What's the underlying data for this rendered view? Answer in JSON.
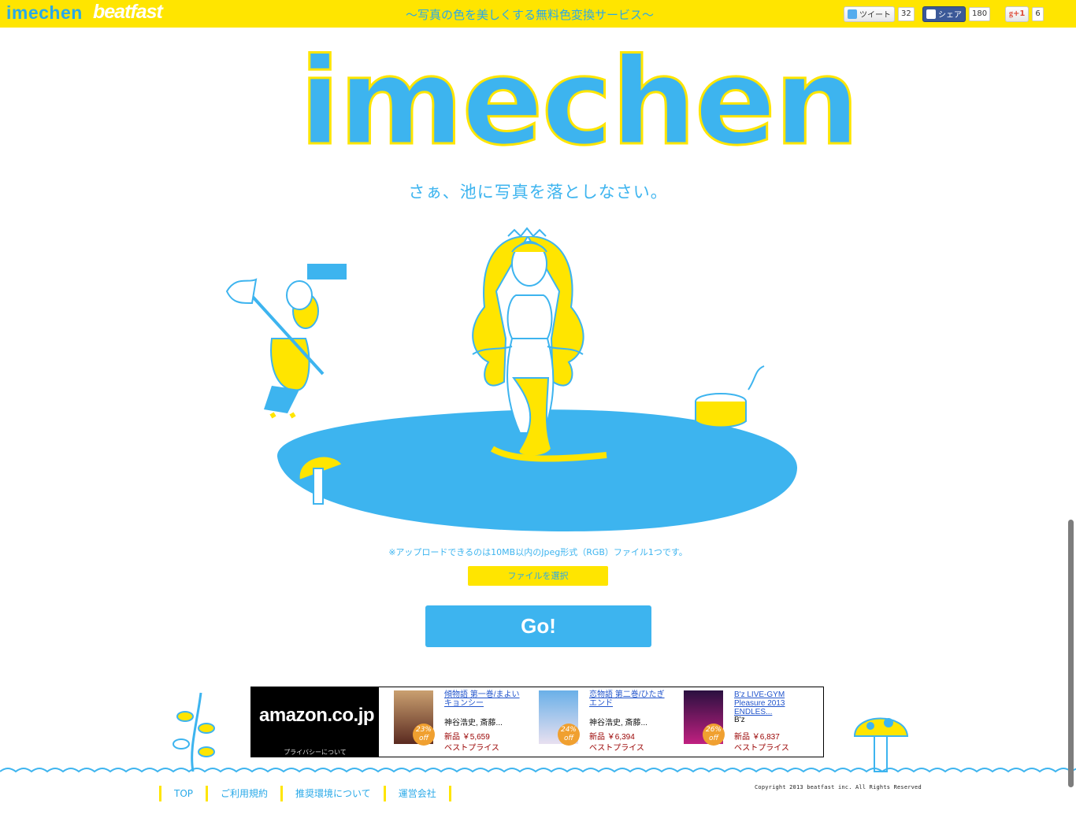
{
  "header": {
    "brand": "imechen",
    "brand2": "beatfast",
    "tagline": "〜写真の色を美しくする無料色変換サービス〜",
    "social": {
      "tweet_label": "ツイート",
      "tweet_count": "32",
      "share_label": "シェア",
      "share_count": "180",
      "gplus_label": "+1",
      "gplus_count": "6"
    }
  },
  "hero": {
    "logo": "imechen",
    "subtitle": "さぁ、池に写真を落としなさい。"
  },
  "upload": {
    "note": "※アップロードできるのは10MB以内のJpeg形式（RGB）ファイル1つです。",
    "file_button": "ファイルを選択",
    "go_button": "Go!"
  },
  "amazon": {
    "wordmark": "amazon.co.jp",
    "privacy": "プライバシーについて",
    "items": [
      {
        "title": "傾物語 第一巻/まよいキョンシー",
        "author": "神谷浩史, 斎藤...",
        "price": "新品 ￥5,659",
        "best": "ベストプライス",
        "discount": "23% off"
      },
      {
        "title": "恋物語 第二巻/ひたぎエンド",
        "author": "神谷浩史, 斎藤...",
        "price": "新品 ￥6,394",
        "best": "ベストプライス",
        "discount": "24% off"
      },
      {
        "title": "B'z LIVE-GYM Pleasure 2013 ENDLES...",
        "author": "B'z",
        "price": "新品 ￥6,837",
        "best": "ベストプライス",
        "discount": "26% off"
      }
    ]
  },
  "footer": {
    "nav": [
      "TOP",
      "ご利用規約",
      "推奨環境について",
      "運営会社"
    ],
    "copyright": "Copyright 2013 beatfast inc. All Rights Reserved"
  },
  "colors": {
    "yellow": "#ffe500",
    "blue": "#3db4ef"
  }
}
